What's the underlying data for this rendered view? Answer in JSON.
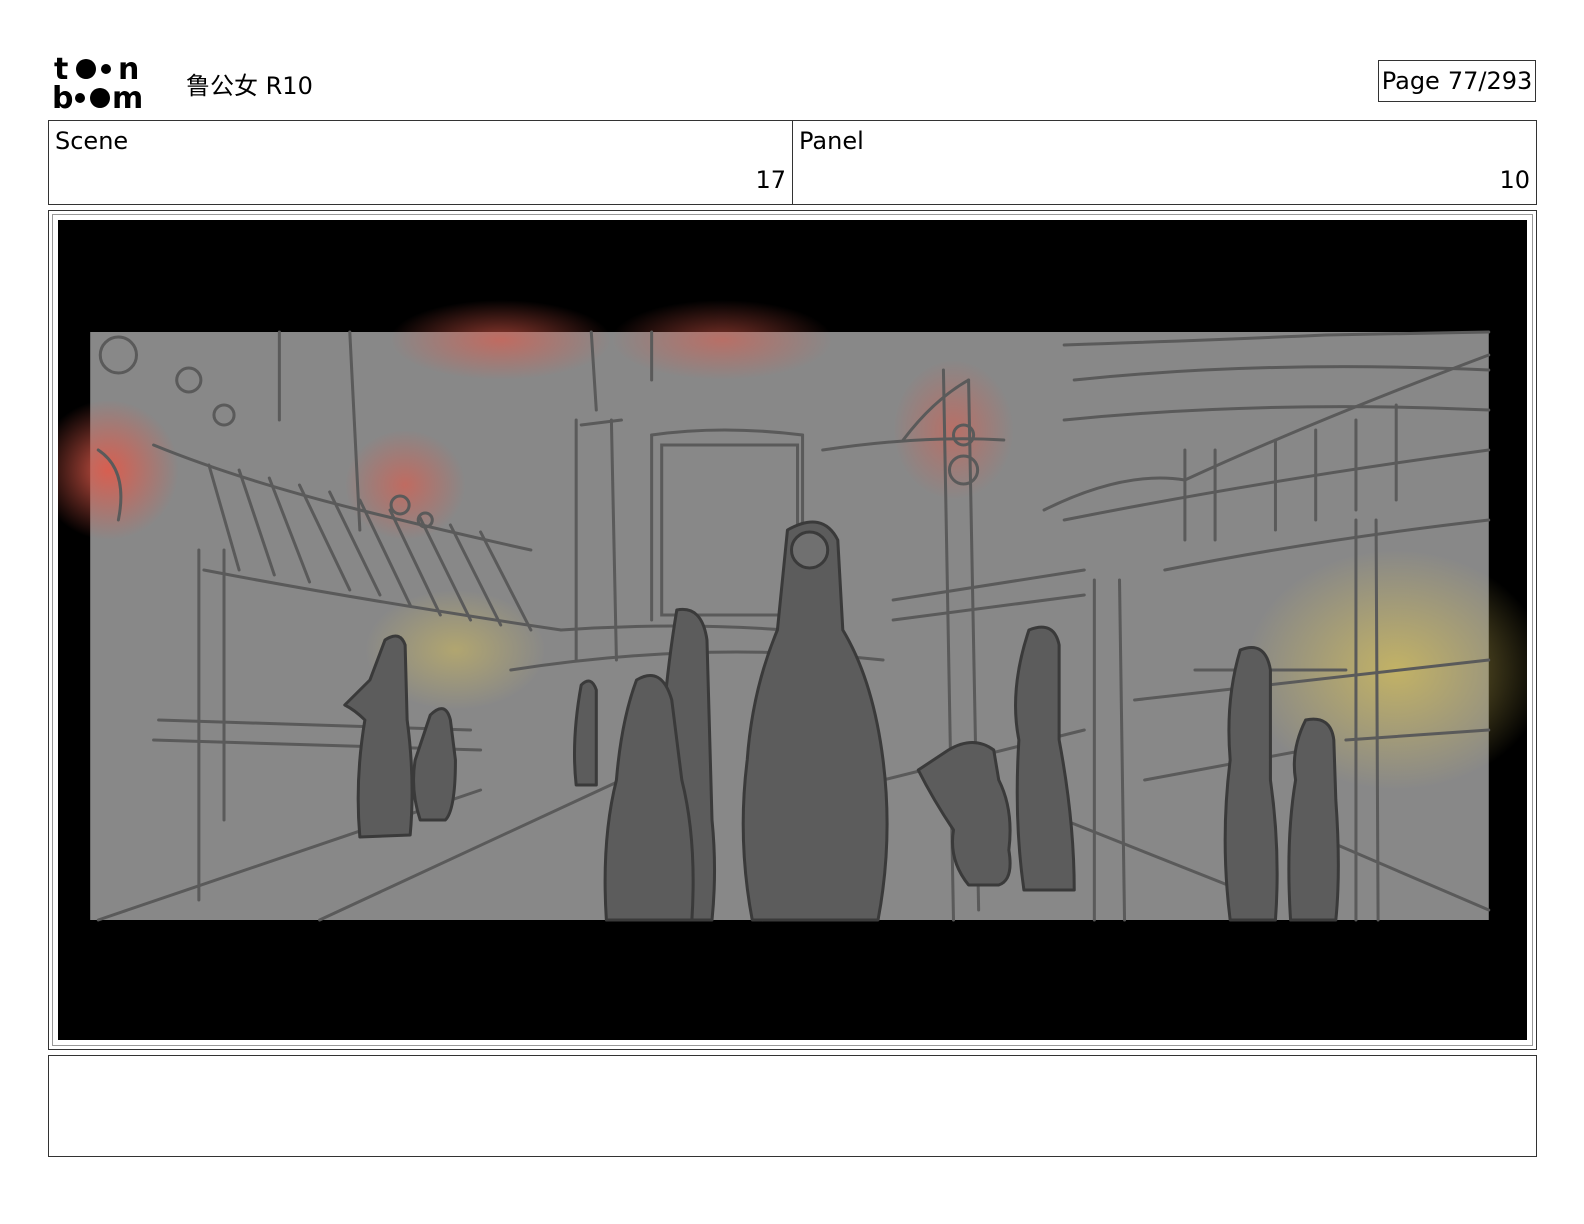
{
  "header": {
    "logo": {
      "name": "toonboom-logo",
      "line1": "t  n",
      "line2": "b    m"
    },
    "project_title": "鲁公女 R10",
    "page_label": "Page",
    "page_value": "77/293"
  },
  "info": {
    "scene_label": "Scene",
    "scene_value": "17",
    "panel_label": "Panel",
    "panel_value": "10"
  },
  "panel": {
    "image_semantic": "storyboard-sketch-market-street-night",
    "colors": {
      "letterbox": "#000000",
      "sky": "#888888",
      "figure_dark": "#555555",
      "lantern_red": "#e05a4a",
      "lantern_yellow": "#d6c05a"
    }
  },
  "notes": {
    "text": ""
  }
}
